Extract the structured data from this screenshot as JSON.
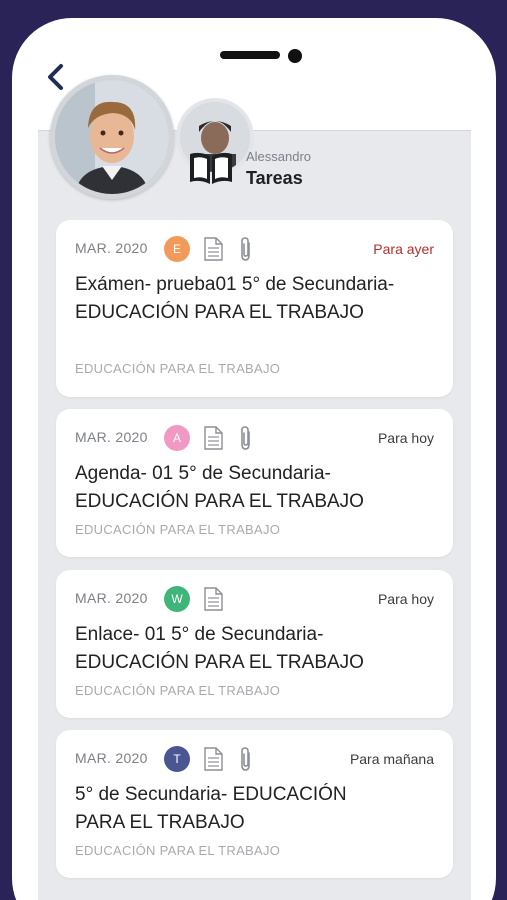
{
  "header": {
    "user_name": "Alessandro",
    "section_title": "Tareas"
  },
  "colors": {
    "frame": "#2a2357",
    "overdue": "#b3302e",
    "badge_e": "#f39a5a",
    "badge_a": "#f09ac3",
    "badge_w": "#3fb57a",
    "badge_t": "#4a5591"
  },
  "tasks": [
    {
      "date": "MAR. 2020",
      "badge": "E",
      "due": "Para ayer",
      "title": "Exámen- prueba01 5° de Secundaria- EDUCACIÓN PARA EL TRABAJO",
      "subject": "EDUCACIÓN PARA EL TRABAJO",
      "has_attachment": true
    },
    {
      "date": "MAR. 2020",
      "badge": "A",
      "due": "Para hoy",
      "title": "Agenda- 01 5° de Secundaria- EDUCACIÓN PARA EL TRABAJO",
      "subject": "EDUCACIÓN PARA EL TRABAJO",
      "has_attachment": true
    },
    {
      "date": "MAR. 2020",
      "badge": "W",
      "due": "Para hoy",
      "title": "Enlace- 01 5° de Secundaria- EDUCACIÓN PARA EL TRABAJO",
      "subject": "EDUCACIÓN PARA EL TRABAJO",
      "has_attachment": false
    },
    {
      "date": "MAR. 2020",
      "badge": "T",
      "due": "Para mañana",
      "title": "5° de Secundaria- EDUCACIÓN PARA EL TRABAJO",
      "subject": "EDUCACIÓN PARA EL TRABAJO",
      "has_attachment": true
    }
  ]
}
